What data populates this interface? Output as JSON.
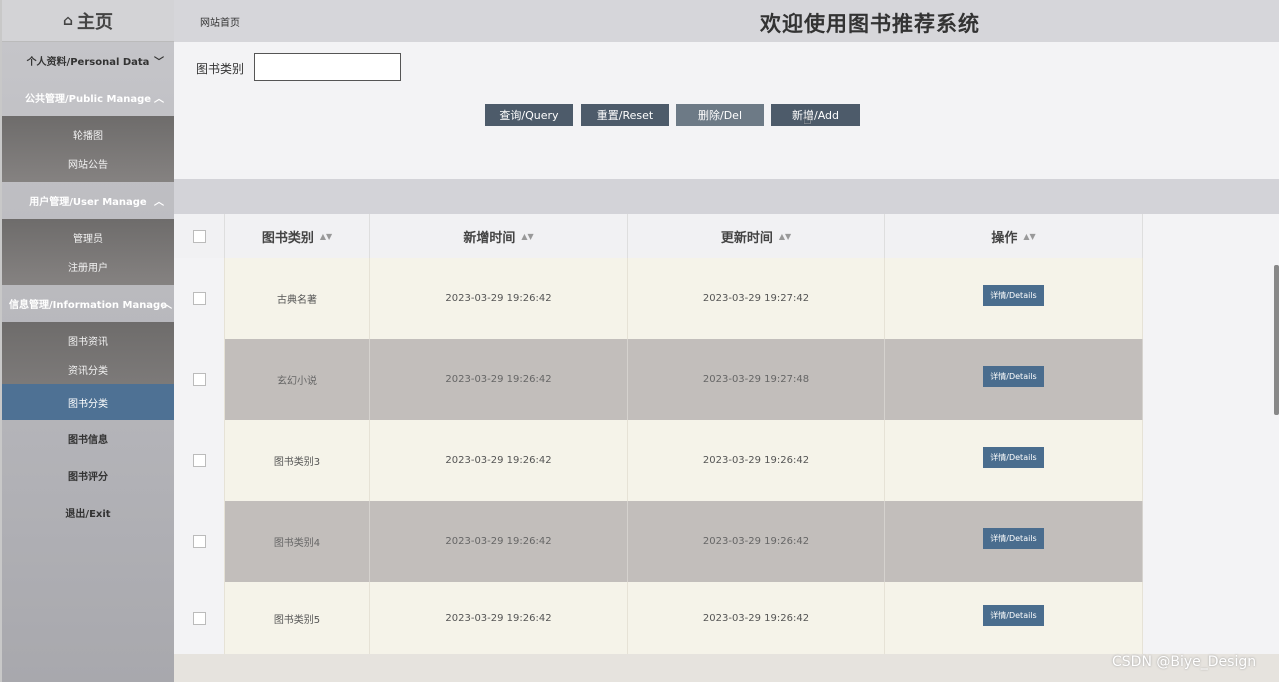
{
  "sidebar": {
    "logo": "主页",
    "groups": [
      {
        "label": "个人资料/Personal Data",
        "chevron": "chevron-down"
      },
      {
        "label": "公共管理/Public Manage",
        "chevron": "chevron-up",
        "items": [
          "轮播图",
          "网站公告"
        ]
      },
      {
        "label": "用户管理/User Manage",
        "chevron": "chevron-up",
        "items": [
          "管理员",
          "注册用户"
        ]
      },
      {
        "label": "信息管理/Information Manage",
        "chevron": "chevron-up",
        "items": [
          "图书资讯",
          "资讯分类"
        ]
      }
    ],
    "active_item": "图书分类",
    "plain_items": [
      "图书信息",
      "图书评分",
      "退出/Exit"
    ]
  },
  "topbar": {
    "breadcrumb": "网站首页",
    "title": "欢迎使用图书推荐系统"
  },
  "search": {
    "label": "图书类别",
    "value": "",
    "buttons": {
      "query": "查询/Query",
      "reset": "重置/Reset",
      "delete": "删除/Del",
      "add": "新增/Add"
    }
  },
  "table": {
    "headers": {
      "category": "图书类别",
      "created": "新增时间",
      "updated": "更新时间",
      "action": "操作"
    },
    "rows": [
      {
        "category": "古典名著",
        "created": "2023-03-29 19:26:42",
        "updated": "2023-03-29 19:27:42",
        "action": "详情/Details"
      },
      {
        "category": "玄幻小说",
        "created": "2023-03-29 19:26:42",
        "updated": "2023-03-29 19:27:48",
        "action": "详情/Details"
      },
      {
        "category": "图书类别3",
        "created": "2023-03-29 19:26:42",
        "updated": "2023-03-29 19:26:42",
        "action": "详情/Details"
      },
      {
        "category": "图书类别4",
        "created": "2023-03-29 19:26:42",
        "updated": "2023-03-29 19:26:42",
        "action": "详情/Details"
      },
      {
        "category": "图书类别5",
        "created": "2023-03-29 19:26:42",
        "updated": "2023-03-29 19:26:42",
        "action": "详情/Details"
      }
    ]
  },
  "watermark": "CSDN @Biye_Design",
  "colors": {
    "active_nav": "#4c7698",
    "button": "#4d5b6a",
    "row_odd": "#f5f3e9",
    "row_even": "#c2bebb"
  }
}
